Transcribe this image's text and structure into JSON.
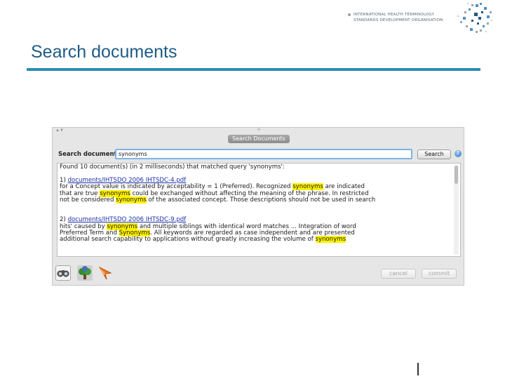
{
  "header": {
    "org_line1": "INTERNATIONAL HEALTH TERMINOLOGY",
    "org_line2": "STANDARDS DEVELOPMENT ORGANISATION"
  },
  "slide": {
    "title": "Search documents"
  },
  "dialog": {
    "group_title": "Search Documents",
    "search_label": "Search documents:",
    "search_value": "synonyms",
    "search_button": "Search",
    "help_symbol": "?",
    "cancel_label": "cancel",
    "commit_label": "commit"
  },
  "results": {
    "summary": "Found 10 document(s) (in 2 milliseconds) that matched query 'synonyms':",
    "items": [
      {
        "number": "1)",
        "link": "documents/IHTSDO 2006 IHTSDC-4.pdf",
        "l1": [
          "for a Concept value is indicated by acceptability = 1 (Preferred). Recognized ",
          "synonyms",
          " are indicated"
        ],
        "l2": [
          "that are true ",
          "synonyms",
          " could be exchanged without affecting the meaning of the phrase. In restricted"
        ],
        "l3": [
          "not be considered ",
          "synonyms",
          " of the associated concept. Those descriptions should not be used in search"
        ]
      },
      {
        "number": "2)",
        "link": "documents/IHTSDO 2006 IHTSDC-9.pdf",
        "l1": [
          "hits' caused by ",
          "synonyms",
          " and multiple siblings with identical word matches ... Integration of word"
        ],
        "l2": [
          "Preferred Term and ",
          "Synonyms",
          ". All keywords are regarded as case independent and are presented"
        ],
        "l3": [
          "additional search capability to applications without greatly increasing the volume of ",
          "synonyms",
          ""
        ]
      }
    ]
  },
  "icons": [
    "binoculars-icon",
    "tree-icon",
    "arrow-icon"
  ],
  "colors": {
    "title": "#1f5b86",
    "rule": "#2a8db6",
    "highlight": "#fff200",
    "link": "#1c2fa8"
  }
}
